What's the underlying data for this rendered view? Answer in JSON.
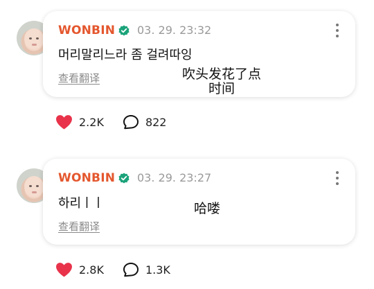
{
  "posts": [
    {
      "author": "WONBIN",
      "timestamp": "03. 29. 23:32",
      "message": "머리말리느라 좀 걸려따잉",
      "translate_label": "查看翻译",
      "translation_overlay": "吹头发花了点\n时间",
      "likes": "2.2K",
      "comments": "822"
    },
    {
      "author": "WONBIN",
      "timestamp": "03. 29. 23:27",
      "message": "하리ㅣㅣ",
      "translate_label": "查看翻译",
      "translation_overlay": "哈喽",
      "likes": "2.8K",
      "comments": "1.3K"
    }
  ],
  "colors": {
    "author_name": "#e4572e",
    "verified_badge": "#1ba37a",
    "like_heart": "#e8334a"
  },
  "icons": [
    "avatar",
    "verified-icon",
    "more-options-icon",
    "heart-icon",
    "comment-icon"
  ]
}
